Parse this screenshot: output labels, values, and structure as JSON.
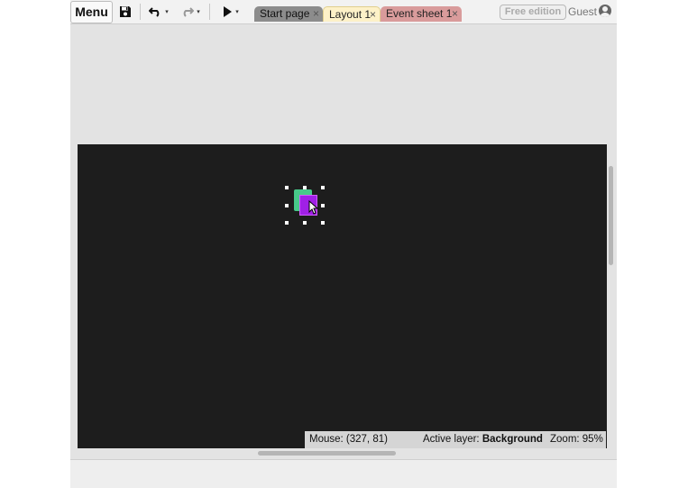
{
  "toolbar": {
    "menu_label": "Menu",
    "save_icon": "save-icon",
    "undo_icon": "undo-icon",
    "redo_icon": "redo-icon",
    "play_icon": "play-icon",
    "arrow_glyph": "▾"
  },
  "tabs": [
    {
      "label": "Start page",
      "close": "×",
      "color": "#8c8c8c"
    },
    {
      "label": "Layout 1",
      "close": "×",
      "color": "#fdf1c8"
    },
    {
      "label": "Event sheet 1",
      "close": "×",
      "color": "#d99b9b"
    }
  ],
  "account": {
    "edition_label": "Free edition",
    "user_label": "Guest",
    "user_icon": "user-icon"
  },
  "layout": {
    "background_color": "#1d1d1d",
    "sprites": [
      {
        "name": "green-sprite",
        "color": "#47c98a"
      },
      {
        "name": "purple-sprite",
        "color": "#a020e6"
      }
    ]
  },
  "status": {
    "mouse": "Mouse: (327, 81)",
    "active_layer_prefix": "Active layer: ",
    "active_layer": "Background",
    "zoom": "Zoom: 95%"
  }
}
